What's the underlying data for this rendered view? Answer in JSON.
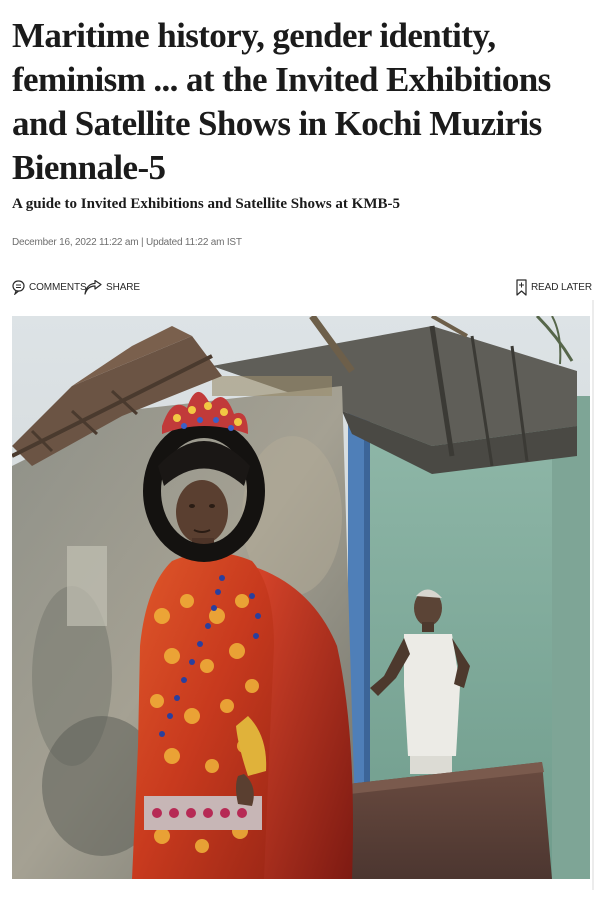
{
  "article": {
    "headline": "Maritime history, gender identity, feminism ... at the Invited Exhibitions and Satellite Shows in Kochi Muziris Biennale-5",
    "subheadline": "A guide to Invited Exhibitions and Satellite Shows at KMB-5",
    "published": "December 16, 2022 11:22 am",
    "separator": " | ",
    "updated": "Updated 11:22 am IST"
  },
  "actions": {
    "comments_label": "COMMENTS",
    "share_label": "SHARE",
    "read_later_label": "READ LATER"
  },
  "icons": {
    "comments": "comments-icon",
    "share": "share-icon",
    "read_later": "bookmark-icon"
  },
  "colors": {
    "text": "#1b1b1b",
    "meta": "#6e6e6e"
  }
}
